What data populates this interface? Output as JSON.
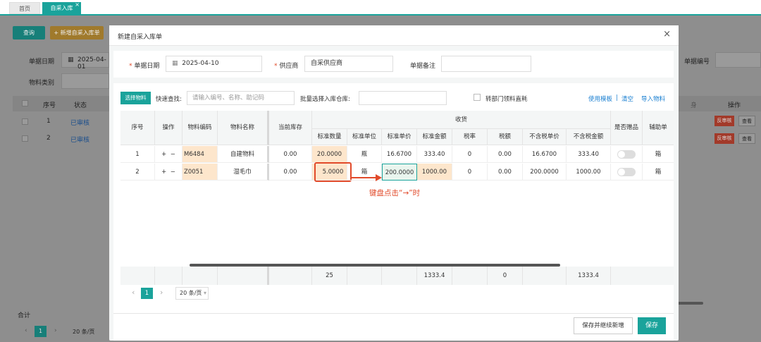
{
  "tabs": [
    {
      "label": "首页"
    },
    {
      "label": "自采入库"
    }
  ],
  "background": {
    "query_button": "查询",
    "new_button": "+ 新增自采入库单",
    "date_label": "单据日期",
    "date_value": "2025-04-01",
    "category_label": "物料类别",
    "doc_no_label": "单据编号",
    "col_seq": "序号",
    "col_status": "状态",
    "col_ops": "操作",
    "rows": [
      {
        "seq": "1",
        "status": "已审核",
        "unapprove": "反审核",
        "view": "查看"
      },
      {
        "seq": "2",
        "status": "已审核",
        "unapprove": "反审核",
        "view": "查看"
      }
    ],
    "total_label": "合计",
    "page": "1",
    "page_size": "20 条/页"
  },
  "modal": {
    "title": "新建自采入库单",
    "close": "×",
    "form": {
      "date_label": "单据日期",
      "date_value": "2025-04-10",
      "supplier_label": "供应商",
      "supplier_value": "自采供应商",
      "remark_label": "单据备注",
      "remark_value": ""
    },
    "toolbar": {
      "select_button": "选择物料",
      "quick_search_label": "快速查找:",
      "quick_search_placeholder": "请输入编号、名称、助记码",
      "batch_label": "批量选择入库仓库:",
      "dept_checkbox_label": "转部门领料直耗",
      "use_template": "使用模板",
      "sep": "|",
      "clear": "清空",
      "import": "导入物料"
    },
    "table": {
      "group_header": "收货",
      "headers": {
        "seq": "序号",
        "ops": "操作",
        "code": "物料编码",
        "name": "物料名称",
        "stock": "当前库存",
        "qty": "标准数量",
        "unit": "标准单位",
        "price": "标准单价",
        "amount": "标准金额",
        "tax_rate": "税率",
        "tax": "税额",
        "net_price": "不含税单价",
        "net_amount": "不含税金额",
        "gift": "是否赠品",
        "aux": "辅助单"
      },
      "rows": [
        {
          "seq": "1",
          "ops_add": "+",
          "ops_del": "−",
          "code": "M6484",
          "name": "自建物料",
          "stock": "0.00",
          "qty": "20.0000",
          "unit": "瓶",
          "price": "16.6700",
          "amount": "333.40",
          "tax_rate": "0",
          "tax": "0.00",
          "net_price": "16.6700",
          "net_amount": "333.40",
          "aux": "箱"
        },
        {
          "seq": "2",
          "ops_add": "+",
          "ops_del": "−",
          "code": "Z0051",
          "name": "湿毛巾",
          "stock": "0.00",
          "qty": "5.0000",
          "unit": "箱",
          "price": "200.0000",
          "amount": "1000.00",
          "tax_rate": "0",
          "tax": "0.00",
          "net_price": "200.0000",
          "net_amount": "1000.00",
          "aux": "箱"
        }
      ],
      "totals": {
        "qty": "25",
        "amount": "1333.4",
        "tax": "0",
        "net_amount": "1333.4"
      }
    },
    "annotation": "键盘点击“→”时",
    "pagination": {
      "page": "1",
      "page_size": "20 条/页"
    },
    "save_continue": "保存并继续新增",
    "save": "保存"
  },
  "colors": {
    "accent": "#1aa39b",
    "highlight": "#fde6cc",
    "annotation": "#e14a2a"
  }
}
